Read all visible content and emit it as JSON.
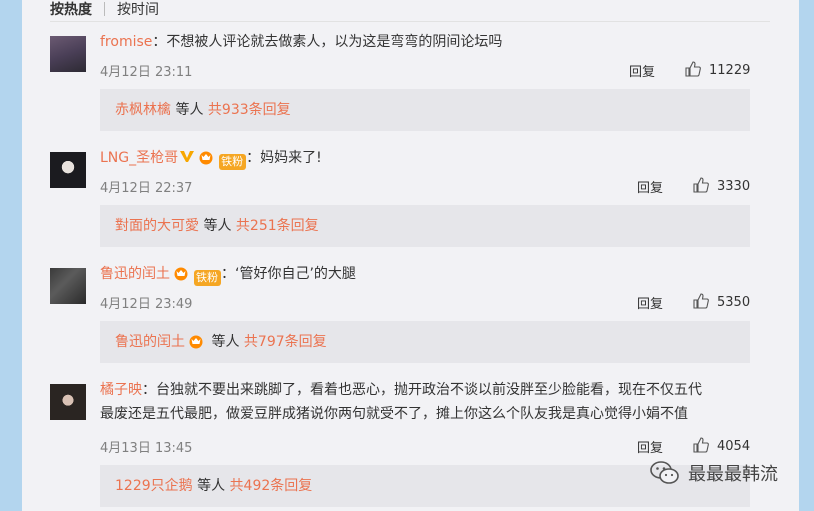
{
  "sort": {
    "hot_label": "按热度",
    "time_label": "按时间"
  },
  "reply_label": "回复",
  "comments": [
    {
      "user": "fromise",
      "colon": "：",
      "text": "不想被人评论就去做素人，以为这是弯弯的阴间论坛吗",
      "date": "4月12日 23:11",
      "likes": "11229",
      "sub_name": "赤枫林檎",
      "sub_mid": " 等人 ",
      "sub_count": "共933条回复"
    },
    {
      "user": "LNG_圣枪哥",
      "badge_fan": "铁粉",
      "colon": "：",
      "text": "妈妈来了!",
      "date": "4月12日 22:37",
      "likes": "3330",
      "sub_name": "對面的大可愛",
      "sub_mid": " 等人 ",
      "sub_count": "共251条回复"
    },
    {
      "user": "鲁迅的闰土",
      "badge_fan": "铁粉",
      "colon": "：",
      "text": "‘管好你自己’的大腿",
      "date": "4月12日 23:49",
      "likes": "5350",
      "sub_name": "鲁迅的闰土",
      "sub_mid": " 等人 ",
      "sub_count": "共797条回复"
    },
    {
      "user": "橘子映",
      "colon": "：",
      "text_line1": "台独就不要出来跳脚了，看着也恶心，抛开政治不谈以前没胖至少脸能看，现在不仅五代",
      "text_line2": "最废还是五代最肥，做爱豆胖成猪说你两句就受不了，摊上你这么个队友我是真心觉得小娟不值",
      "date": "4月13日 13:45",
      "likes": "4054",
      "sub_name": "1229只企鹅",
      "sub_mid": " 等人 ",
      "sub_count": "共492条回复"
    }
  ],
  "watermark": {
    "text": "最最最韩流",
    "icon": "wechat-icon"
  },
  "colors": {
    "accent": "#eb7350",
    "panel_bg": "#f2f2f5",
    "outer_bg": "#b3d5ee",
    "sub_bg": "#e6e6ea"
  }
}
